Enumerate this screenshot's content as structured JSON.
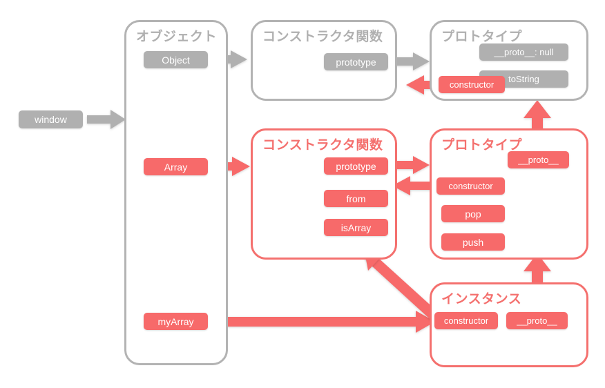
{
  "diagram": {
    "title": "JavaScript prototype chain diagram",
    "colors": {
      "gray": "#b0b0b0",
      "gray_border": "#b3b3b3",
      "red": "#f76a6a",
      "red_border": "#f4706e",
      "background": "#ffffff",
      "text_on_pill": "#ffffff"
    }
  },
  "global": {
    "window_label": "window"
  },
  "object_group": {
    "title": "オブジェクト",
    "items": [
      {
        "label": "Object",
        "color": "gray"
      },
      {
        "label": "Array",
        "color": "red"
      },
      {
        "label": "myArray",
        "color": "red"
      }
    ]
  },
  "object_constructor_group": {
    "title": "コンストラクタ関数",
    "items": [
      {
        "label": "prototype",
        "color": "gray"
      }
    ]
  },
  "object_prototype_group": {
    "title": "プロトタイプ",
    "items": [
      {
        "label": "__proto__: null",
        "color": "gray"
      },
      {
        "label": "toString",
        "color": "gray"
      },
      {
        "label": "constructor",
        "color": "red"
      }
    ]
  },
  "array_constructor_group": {
    "title": "コンストラクタ関数",
    "items": [
      {
        "label": "prototype",
        "color": "red"
      },
      {
        "label": "from",
        "color": "red"
      },
      {
        "label": "isArray",
        "color": "red"
      }
    ]
  },
  "array_prototype_group": {
    "title": "プロトタイプ",
    "items": [
      {
        "label": "__proto__",
        "color": "red"
      },
      {
        "label": "constructor",
        "color": "red"
      },
      {
        "label": "pop",
        "color": "red"
      },
      {
        "label": "push",
        "color": "red"
      }
    ]
  },
  "instance_group": {
    "title": "インスタンス",
    "items": [
      {
        "label": "constructor",
        "color": "red"
      },
      {
        "label": "__proto__",
        "color": "red"
      }
    ]
  },
  "arrows": [
    {
      "name": "window-to-object",
      "color": "gray",
      "direction": "right"
    },
    {
      "name": "object-to-object-constructor",
      "color": "gray",
      "direction": "right"
    },
    {
      "name": "object-prototype-to-constructor",
      "color": "gray",
      "direction": "right"
    },
    {
      "name": "object-constructor-back-to-object-prototype",
      "color": "red",
      "direction": "left"
    },
    {
      "name": "array-to-array-constructor",
      "color": "red",
      "direction": "right"
    },
    {
      "name": "array-prototype-to-array-constructor",
      "color": "red",
      "direction": "right"
    },
    {
      "name": "array-prototype-constructor-back",
      "color": "red",
      "direction": "left"
    },
    {
      "name": "array-proto-up-to-object-prototype",
      "color": "red",
      "direction": "up"
    },
    {
      "name": "instance-proto-up-to-array-prototype",
      "color": "red",
      "direction": "up"
    },
    {
      "name": "myarray-to-instance",
      "color": "red",
      "direction": "right"
    },
    {
      "name": "instance-constructor-to-array-constructor",
      "color": "red",
      "direction": "diagonal-up-left"
    }
  ]
}
